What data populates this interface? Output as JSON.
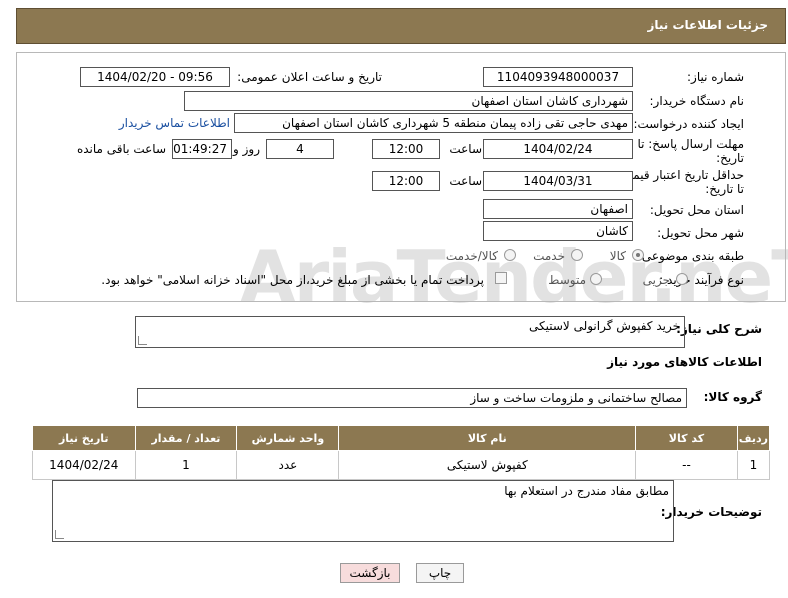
{
  "header": {
    "title": "جزئیات اطلاعات نیاز"
  },
  "form": {
    "need_number_label": "شماره نیاز:",
    "need_number": "1104093948000037",
    "announce_label": "تاریخ و ساعت اعلان عمومی:",
    "announce_value": "1404/02/20 - 09:56",
    "buyer_org_label": "نام دستگاه خریدار:",
    "buyer_org": "شهرداری کاشان استان اصفهان",
    "creator_label": "ایجاد کننده درخواست:",
    "creator": "مهدی حاجی تقی زاده پیمان منطقه 5 شهرداری کاشان استان اصفهان",
    "contact_link": "اطلاعات تماس خریدار",
    "deadline_label_1": "مهلت ارسال پاسخ: تا",
    "deadline_label_2": "تاریخ:",
    "deadline_date": "1404/02/24",
    "time_label": "ساعت",
    "deadline_time": "12:00",
    "days_value": "4",
    "days_label": "روز و",
    "remaining_value": "01:49:27",
    "remaining_label": "ساعت باقی مانده",
    "validity_label_1": "حداقل تاریخ اعتبار قیمت:",
    "validity_label_2": "تا تاریخ:",
    "validity_date": "1404/03/31",
    "validity_time": "12:00",
    "province_label": "استان محل تحویل:",
    "province": "اصفهان",
    "city_label": "شهر محل تحویل:",
    "city": "کاشان",
    "category_label": "طبقه بندی موضوعی:",
    "category_options": [
      "کالا",
      "خدمت",
      "کالا/خدمت"
    ],
    "category_selected": "کالا",
    "process_label": "نوع فرآیند خرید :",
    "process_options": [
      "جزیی",
      "متوسط"
    ],
    "payment_note": "پرداخت تمام یا بخشی از مبلغ خرید،از محل \"اسناد خزانه اسلامی\" خواهد بود."
  },
  "description": {
    "label": "شرح کلی نیاز:",
    "value": "خرید کفپوش گرانولی لاستیکی"
  },
  "goods": {
    "section_title": "اطلاعات کالاهای مورد نیاز",
    "group_label": "گروه کالا:",
    "group_value": "مصالح ساختمانی و ملزومات ساخت و ساز",
    "columns": [
      "ردیف",
      "کد کالا",
      "نام کالا",
      "واحد شمارش",
      "تعداد / مقدار",
      "تاریخ نیاز"
    ],
    "rows": [
      [
        "1",
        "--",
        "کفپوش لاستیکی",
        "عدد",
        "1",
        "1404/02/24"
      ]
    ]
  },
  "buyer_notes": {
    "label": "توضیحات خریدار:",
    "value": "مطابق مفاد مندرج در استعلام بها"
  },
  "buttons": {
    "print": "چاپ",
    "back": "بازگشت"
  },
  "watermark": "AriaTender.neT"
}
